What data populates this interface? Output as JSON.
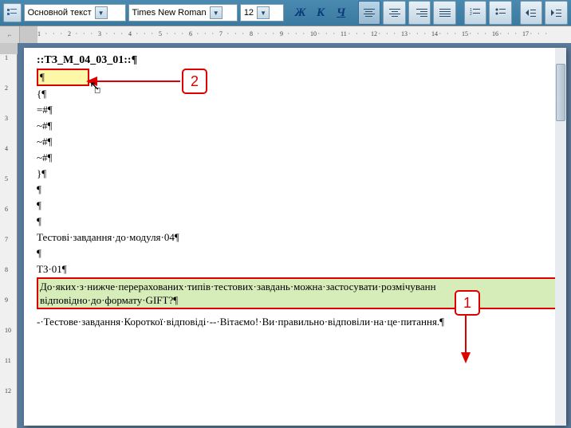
{
  "toolbar": {
    "style_label": "Основной текст",
    "font_label": "Times New Roman",
    "size_label": "12",
    "bold": "Ж",
    "italic": "К",
    "underline": "Ч"
  },
  "ruler": {
    "hticks": [
      "1",
      "2",
      "3",
      "4",
      "5",
      "6",
      "7",
      "8",
      "9",
      "10",
      "11",
      "12",
      "13",
      "14",
      "15",
      "16",
      "17"
    ],
    "vticks": [
      "1",
      "2",
      "3",
      "4",
      "5",
      "6",
      "7",
      "8",
      "9",
      "10",
      "11",
      "12"
    ]
  },
  "document": {
    "title": "::ТЗ_М_04_03_01::¶",
    "blank_hl": "¶",
    "lines_group1": [
      "{¶",
      "=#¶",
      "~#¶",
      "~#¶",
      "~#¶",
      "}¶",
      "¶",
      "¶",
      "¶"
    ],
    "line_module": "Тестові·завдання·до·модуля·04¶",
    "line_blank2": "¶",
    "line_tz": "ТЗ·01¶",
    "question_line1": "До·яких·з·нижче·перерахованих·типів·тестових·завдань·можна·застосувати·розмічуванн",
    "question_line2": "відповідно·до·формату·GIFT?¶",
    "last_line": "-·Тестове·завдання·Короткої·відповіді·--·Вітаємо!·Ви·правильно·відповіли·на·це·питання.¶"
  },
  "callouts": {
    "c1": "1",
    "c2": "2"
  }
}
